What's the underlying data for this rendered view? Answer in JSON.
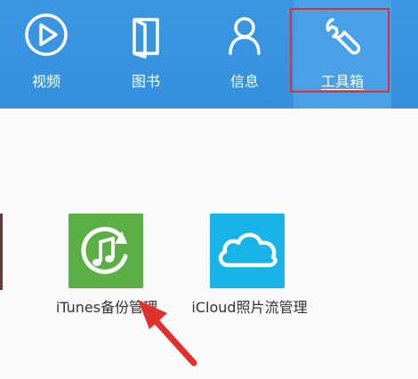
{
  "nav": {
    "items": [
      {
        "label": "视频",
        "icon": "play-circle-icon"
      },
      {
        "label": "图书",
        "icon": "book-icon"
      },
      {
        "label": "信息",
        "icon": "person-icon"
      },
      {
        "label": "工具箱",
        "icon": "wrench-icon",
        "selected": true
      }
    ]
  },
  "apps": [
    {
      "label": "iTunes备份管理",
      "icon": "itunes-backup-icon",
      "color": "#5ab045"
    },
    {
      "label": "iCloud照片流管理",
      "icon": "icloud-icon",
      "color": "#18b4e8"
    }
  ],
  "colors": {
    "topbar": "#3390dd",
    "highlight": "#e0302e",
    "annotation_arrow": "#e0302e"
  }
}
